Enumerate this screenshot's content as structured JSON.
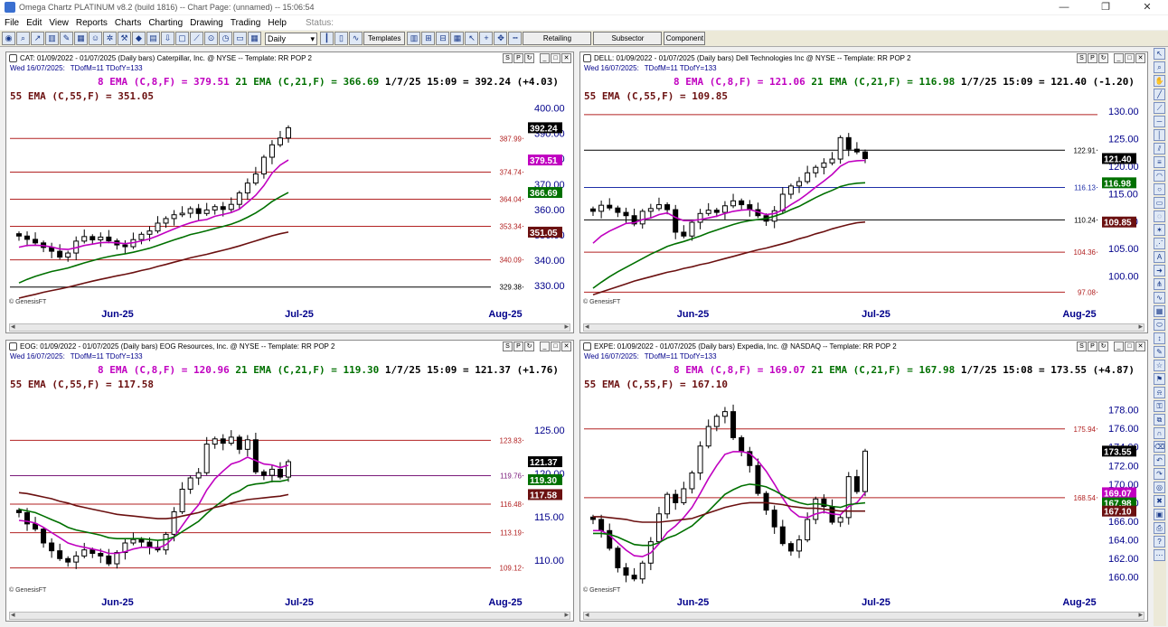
{
  "window": {
    "title": "Omega Chartz PLATINUM v8.2 (build 1816)  --  Chart Page: (unnamed) -- 15:06:54"
  },
  "menu": [
    "File",
    "Edit",
    "View",
    "Reports",
    "Charts",
    "Charting",
    "Drawing",
    "Trading",
    "Help"
  ],
  "status_label": "Status:",
  "toolbar": {
    "period": "Daily",
    "templates": "Templates",
    "retailing": "Retailing",
    "subsector": "Subsector",
    "component": "Component"
  },
  "panes": [
    {
      "header": "CAT: 01/09/2022 - 01/07/2025  (Daily bars)   Caterpillar, Inc. @ NYSE  --  Template: RR POP 2",
      "date_line": "Wed  16/07/2025:",
      "tdm": "TDofM=11  TDofY=133",
      "ema_line1": {
        "ema8": "8 EMA (C,8,F) = 379.51",
        "ema21": "21 EMA (C,21,F) = 366.69",
        "last": "1/7/25 15:09 = 392.24 (+4.03)"
      },
      "ema_line2": "55 EMA (C,55,F) = 351.05",
      "copyright": "© GenesisFT",
      "ymin": 325,
      "ymax": 402,
      "yticks": [
        "400.00",
        "390.00",
        "380.00",
        "370.00",
        "360.00",
        "350.00",
        "340.00",
        "330.00"
      ],
      "hlines": [
        {
          "v": 387.99,
          "label": "387.99",
          "color": "#b22222"
        },
        {
          "v": 374.74,
          "label": "374.74",
          "color": "#b22222"
        },
        {
          "v": 364.04,
          "label": "364.04",
          "color": "#b22222"
        },
        {
          "v": 353.34,
          "label": "353.34",
          "color": "#b22222"
        },
        {
          "v": 340.09,
          "label": "340.09",
          "color": "#b22222"
        },
        {
          "v": 329.38,
          "label": "329.38",
          "color": "#000000"
        }
      ],
      "tags": [
        {
          "v": 392.24,
          "label": "392.24",
          "bg": "#000000"
        },
        {
          "v": 379.51,
          "label": "379.51",
          "bg": "#c000c0"
        },
        {
          "v": 366.69,
          "label": "366.69",
          "bg": "#007000"
        },
        {
          "v": 351.05,
          "label": "351.05",
          "bg": "#6b1010"
        }
      ],
      "xlabels": [
        "Jun-25",
        "Jul-25",
        "Aug-25"
      ],
      "series": {
        "close": [
          349.5,
          348.2,
          346.8,
          345.0,
          343.5,
          341.2,
          342.8,
          347.5,
          349.3,
          348.0,
          349.1,
          347.6,
          346.0,
          345.3,
          348.1,
          350.2,
          351.5,
          354.6,
          356.4,
          357.9,
          358.5,
          360.3,
          358.4,
          359.8,
          361.1,
          360.0,
          362.0,
          366.5,
          370.4,
          374.0,
          380.6,
          385.5,
          388.2,
          392.24
        ],
        "ema8": [
          345.1,
          345.8,
          345.9,
          345.7,
          345.2,
          344.4,
          344.2,
          344.9,
          345.8,
          346.3,
          346.9,
          347.0,
          346.8,
          346.5,
          346.9,
          347.6,
          348.4,
          349.6,
          351.0,
          352.3,
          353.6,
          354.7,
          355.6,
          356.0,
          357.3,
          358.0,
          358.8,
          360.1,
          362.8,
          365.6,
          369.4,
          374.3,
          377.5,
          379.51
        ],
        "ema21": [
          331.0,
          332.4,
          333.6,
          334.6,
          335.5,
          336.2,
          336.9,
          337.9,
          338.9,
          339.8,
          340.7,
          341.4,
          342.0,
          342.5,
          343.1,
          343.9,
          344.7,
          345.8,
          346.9,
          348.0,
          349.0,
          350.1,
          350.8,
          351.6,
          352.5,
          353.3,
          354.2,
          355.4,
          356.9,
          358.6,
          360.7,
          363.1,
          365.0,
          366.69
        ],
        "ema55": [
          325.0,
          325.8,
          326.5,
          327.3,
          328.0,
          328.6,
          329.3,
          330.1,
          330.9,
          331.7,
          332.4,
          333.1,
          333.8,
          334.4,
          335.1,
          335.9,
          336.6,
          337.5,
          338.3,
          339.2,
          340.0,
          340.9,
          341.6,
          342.3,
          343.1,
          343.9,
          344.7,
          345.6,
          346.6,
          347.6,
          348.6,
          349.6,
          350.4,
          351.05
        ]
      }
    },
    {
      "header": "DELL: 01/09/2022 - 01/07/2025  (Daily bars)   Dell Technologies Inc @ NYSE  --  Template: RR POP 2",
      "date_line": "Wed  16/07/2025:",
      "tdm": "TDofM=11  TDofY=133",
      "ema_line1": {
        "ema8": "8 EMA (C,8,F) = 121.06",
        "ema21": "21 EMA (C,21,F) = 116.98",
        "last": "1/7/25 15:09 = 121.40 (-1.20)"
      },
      "ema_line2": "55 EMA (C,55,F) = 109.85",
      "copyright": "© GenesisFT",
      "ymin": 96,
      "ymax": 131.5,
      "yticks": [
        "130.00",
        "125.00",
        "120.00",
        "115.00",
        "110.00",
        "105.00",
        "100.00"
      ],
      "hlines": [
        {
          "v": 129.38,
          "label": "",
          "color": "#b22222"
        },
        {
          "v": 122.91,
          "label": "122.91",
          "color": "#000000"
        },
        {
          "v": 116.13,
          "label": "116.13",
          "color": "#1f2fa8"
        },
        {
          "v": 110.24,
          "label": "110.24",
          "color": "#000000"
        },
        {
          "v": 104.36,
          "label": "104.36",
          "color": "#b22222"
        },
        {
          "v": 97.08,
          "label": "97.08",
          "color": "#b22222"
        }
      ],
      "tags": [
        {
          "v": 121.4,
          "label": "121.40",
          "bg": "#000000"
        },
        {
          "v": 116.98,
          "label": "116.98",
          "bg": "#007000"
        },
        {
          "v": 109.85,
          "label": "109.85",
          "bg": "#6b1010"
        }
      ],
      "xlabels": [
        "Jun-25",
        "Jul-25",
        "Aug-25"
      ],
      "series": {
        "close": [
          111.8,
          112.9,
          112.4,
          111.6,
          111.0,
          109.5,
          111.8,
          112.3,
          113.0,
          112.1,
          108.0,
          107.3,
          109.8,
          111.4,
          112.0,
          111.6,
          112.8,
          113.7,
          113.0,
          112.1,
          111.0,
          110.0,
          111.9,
          114.9,
          116.4,
          117.2,
          118.8,
          119.8,
          120.6,
          121.3,
          125.2,
          123.1,
          122.6,
          121.4
        ],
        "ema8": [
          106.0,
          107.3,
          108.2,
          108.9,
          109.6,
          109.7,
          110.3,
          110.6,
          111.2,
          111.5,
          110.7,
          110.1,
          110.1,
          110.3,
          110.6,
          110.9,
          111.4,
          111.8,
          112.0,
          112.1,
          111.7,
          111.2,
          111.4,
          112.0,
          113.0,
          113.9,
          115.0,
          116.2,
          117.3,
          118.5,
          120.0,
          120.8,
          121.0,
          121.06
        ],
        "ema21": [
          97.8,
          98.9,
          99.9,
          100.8,
          101.6,
          102.4,
          103.2,
          104.0,
          104.7,
          105.4,
          105.9,
          106.3,
          106.8,
          107.3,
          107.9,
          108.4,
          108.9,
          109.4,
          109.8,
          110.1,
          110.3,
          110.5,
          110.9,
          111.4,
          112.1,
          112.7,
          113.5,
          114.3,
          115.0,
          115.6,
          116.3,
          116.7,
          116.9,
          116.98
        ],
        "ema55": [
          96.6,
          97.1,
          97.6,
          98.1,
          98.6,
          99.1,
          99.5,
          99.9,
          100.3,
          100.7,
          101.0,
          101.4,
          101.7,
          102.1,
          102.4,
          102.8,
          103.2,
          103.6,
          104.0,
          104.4,
          104.8,
          105.1,
          105.5,
          105.9,
          106.3,
          106.8,
          107.2,
          107.7,
          108.1,
          108.6,
          109.0,
          109.4,
          109.7,
          109.85
        ]
      }
    },
    {
      "header": "EOG: 01/09/2022 - 01/07/2025  (Daily bars)   EOG Resources, Inc. @ NYSE  --  Template: RR POP 2",
      "date_line": "Wed  16/07/2025:",
      "tdm": "TDofM=11  TDofY=133",
      "ema_line1": {
        "ema8": "8 EMA (C,8,F) = 120.96",
        "ema21": "21 EMA (C,21,F) = 119.30",
        "last": "1/7/25 15:09 = 121.37 (+1.76)"
      },
      "ema_line2": "55 EMA (C,55,F) = 117.58",
      "copyright": "© GenesisFT",
      "ymin": 107,
      "ymax": 129.5,
      "yticks": [
        "125.00",
        "120.00",
        "115.00",
        "110.00"
      ],
      "hlines": [
        {
          "v": 123.83,
          "label": "123.83",
          "color": "#b22222"
        },
        {
          "v": 119.76,
          "label": "119.76",
          "color": "#7a1a7a"
        },
        {
          "v": 116.48,
          "label": "116.48",
          "color": "#b22222"
        },
        {
          "v": 113.19,
          "label": "113.19",
          "color": "#b22222"
        },
        {
          "v": 109.12,
          "label": "109.12",
          "color": "#b22222"
        }
      ],
      "tags": [
        {
          "v": 121.37,
          "label": "121.37",
          "bg": "#000000"
        },
        {
          "v": 119.3,
          "label": "119.30",
          "bg": "#007000"
        },
        {
          "v": 117.58,
          "label": "117.58",
          "bg": "#6b1010"
        }
      ],
      "xlabels": [
        "Jun-25",
        "Jul-25",
        "Aug-25"
      ],
      "series": {
        "close": [
          115.5,
          114.2,
          113.6,
          112.0,
          111.1,
          110.2,
          109.8,
          110.5,
          111.2,
          110.8,
          110.5,
          109.6,
          110.9,
          112.0,
          112.4,
          112.1,
          111.5,
          111.2,
          113.0,
          115.6,
          118.2,
          119.5,
          120.1,
          123.4,
          124.0,
          123.5,
          124.2,
          122.8,
          123.9,
          120.2,
          119.8,
          120.5,
          119.6,
          121.37
        ],
        "ema8": [
          114.6,
          114.5,
          114.3,
          113.8,
          113.2,
          112.6,
          112.0,
          111.7,
          111.5,
          111.3,
          111.1,
          110.8,
          110.8,
          111.0,
          111.3,
          111.5,
          111.5,
          111.4,
          111.8,
          112.7,
          114.0,
          115.3,
          116.4,
          118.1,
          119.4,
          120.3,
          121.1,
          121.4,
          121.9,
          121.5,
          121.1,
          121.0,
          120.7,
          120.96
        ],
        "ema21": [
          115.9,
          115.7,
          115.5,
          115.1,
          114.7,
          114.3,
          113.8,
          113.5,
          113.3,
          113.1,
          112.9,
          112.6,
          112.5,
          112.5,
          112.5,
          112.5,
          112.4,
          112.3,
          112.4,
          112.7,
          113.3,
          113.9,
          114.5,
          115.4,
          116.2,
          116.9,
          117.6,
          118.0,
          118.6,
          118.8,
          118.9,
          119.1,
          119.1,
          119.3
        ],
        "ema55": [
          117.8,
          117.7,
          117.5,
          117.3,
          117.1,
          116.8,
          116.6,
          116.3,
          116.1,
          115.9,
          115.7,
          115.5,
          115.3,
          115.2,
          115.1,
          115.0,
          114.9,
          114.8,
          114.8,
          114.9,
          115.1,
          115.3,
          115.5,
          115.8,
          116.1,
          116.3,
          116.6,
          116.8,
          117.0,
          117.1,
          117.2,
          117.3,
          117.4,
          117.58
        ]
      }
    },
    {
      "header": "EXPE: 01/09/2022 - 01/07/2025  (Daily bars)   Expedia, Inc. @ NASDAQ  --  Template: RR POP 2",
      "date_line": "Wed  16/07/2025:",
      "tdm": "TDofM=11  TDofY=133",
      "ema_line1": {
        "ema8": "8 EMA (C,8,F) = 169.07",
        "ema21": "21 EMA (C,21,F) = 167.98",
        "last": "1/7/25 15:08 = 173.55 (+4.87)"
      },
      "ema_line2": "55 EMA (C,55,F) = 167.10",
      "copyright": "© GenesisFT",
      "ymin": 159,
      "ymax": 180,
      "yticks": [
        "178.00",
        "176.00",
        "174.00",
        "172.00",
        "170.00",
        "168.00",
        "166.00",
        "164.00",
        "162.00",
        "160.00"
      ],
      "hlines": [
        {
          "v": 175.94,
          "label": "175.94",
          "color": "#b22222"
        },
        {
          "v": 168.54,
          "label": "168.54",
          "color": "#b22222"
        }
      ],
      "tags": [
        {
          "v": 173.55,
          "label": "173.55",
          "bg": "#000000"
        },
        {
          "v": 169.07,
          "label": "169.07",
          "bg": "#c000c0"
        },
        {
          "v": 167.98,
          "label": "167.98",
          "bg": "#007000"
        },
        {
          "v": 167.1,
          "label": "167.10",
          "bg": "#6b1010"
        }
      ],
      "xlabels": [
        "Jun-25",
        "Jul-25",
        "Aug-25"
      ],
      "series": {
        "close": [
          166.2,
          165.0,
          163.1,
          161.0,
          160.2,
          159.8,
          161.5,
          163.8,
          166.8,
          168.9,
          168.0,
          169.5,
          171.2,
          174.1,
          176.2,
          177.3,
          177.8,
          175.0,
          173.5,
          172.0,
          169.0,
          167.2,
          165.4,
          163.6,
          162.8,
          164.0,
          166.2,
          168.4,
          167.6,
          165.9,
          166.4,
          170.8,
          169.2,
          173.55
        ],
        "ema8": [
          165.0,
          165.0,
          164.5,
          163.7,
          162.9,
          162.3,
          162.2,
          162.6,
          163.6,
          164.8,
          165.5,
          166.4,
          167.5,
          169.0,
          170.6,
          172.0,
          173.2,
          173.5,
          173.5,
          173.3,
          172.5,
          171.4,
          170.0,
          168.5,
          167.2,
          166.5,
          166.4,
          166.8,
          167.0,
          166.8,
          166.7,
          167.6,
          168.0,
          169.07
        ],
        "ema21": [
          164.7,
          164.7,
          164.6,
          164.3,
          163.9,
          163.5,
          163.4,
          163.4,
          163.7,
          164.2,
          164.5,
          165.0,
          165.5,
          166.3,
          167.1,
          168.0,
          168.9,
          169.4,
          169.8,
          170.0,
          169.9,
          169.7,
          169.3,
          168.8,
          168.3,
          168.0,
          167.8,
          167.9,
          167.8,
          167.6,
          167.5,
          167.8,
          167.9,
          167.98
        ],
        "ema55": [
          166.5,
          166.5,
          166.4,
          166.3,
          166.2,
          166.0,
          165.9,
          165.9,
          165.9,
          166.0,
          166.1,
          166.2,
          166.3,
          166.6,
          166.9,
          167.2,
          167.5,
          167.7,
          167.9,
          168.0,
          168.0,
          168.0,
          167.9,
          167.8,
          167.6,
          167.5,
          167.4,
          167.4,
          167.3,
          167.2,
          167.1,
          167.1,
          167.1,
          167.1
        ]
      }
    }
  ],
  "chart_data": [
    {
      "type": "candlestick",
      "title": "CAT: 01/09/2022 - 01/07/2025  (Daily bars)   Caterpillar, Inc. @ NYSE  --  Template: RR POP 2",
      "x": [
        "Jun-25",
        "Jul-25",
        "Aug-25"
      ],
      "ylim": [
        325,
        402
      ],
      "series": [
        {
          "name": "8 EMA (C,8,F)",
          "last": 379.51
        },
        {
          "name": "21 EMA (C,21,F)",
          "last": 366.69
        },
        {
          "name": "55 EMA (C,55,F)",
          "last": 351.05
        }
      ],
      "last": 392.24
    },
    {
      "type": "candlestick",
      "title": "DELL: 01/09/2022 - 01/07/2025  (Daily bars)   Dell Technologies Inc @ NYSE  --  Template: RR POP 2",
      "x": [
        "Jun-25",
        "Jul-25",
        "Aug-25"
      ],
      "ylim": [
        96,
        131.5
      ],
      "series": [
        {
          "name": "8 EMA (C,8,F)",
          "last": 121.06
        },
        {
          "name": "21 EMA (C,21,F)",
          "last": 116.98
        },
        {
          "name": "55 EMA (C,55,F)",
          "last": 109.85
        }
      ],
      "last": 121.4
    },
    {
      "type": "candlestick",
      "title": "EOG: 01/09/2022 - 01/07/2025  (Daily bars)   EOG Resources, Inc. @ NYSE  --  Template: RR POP 2",
      "x": [
        "Jun-25",
        "Jul-25",
        "Aug-25"
      ],
      "ylim": [
        107,
        129.5
      ],
      "series": [
        {
          "name": "8 EMA (C,8,F)",
          "last": 120.96
        },
        {
          "name": "21 EMA (C,21,F)",
          "last": 119.3
        },
        {
          "name": "55 EMA (C,55,F)",
          "last": 117.58
        }
      ],
      "last": 121.37
    },
    {
      "type": "candlestick",
      "title": "EXPE: 01/09/2022 - 01/07/2025  (Daily bars)   Expedia, Inc. @ NASDAQ  --  Template: RR POP 2",
      "x": [
        "Jun-25",
        "Jul-25",
        "Aug-25"
      ],
      "ylim": [
        159,
        180
      ],
      "series": [
        {
          "name": "8 EMA (C,8,F)",
          "last": 169.07
        },
        {
          "name": "21 EMA (C,21,F)",
          "last": 167.98
        },
        {
          "name": "55 EMA (C,55,F)",
          "last": 167.1
        }
      ],
      "last": 173.55
    }
  ],
  "colors": {
    "ema8": "#c000c0",
    "ema21": "#007000",
    "ema55": "#6b1010",
    "info": "#00008b"
  }
}
